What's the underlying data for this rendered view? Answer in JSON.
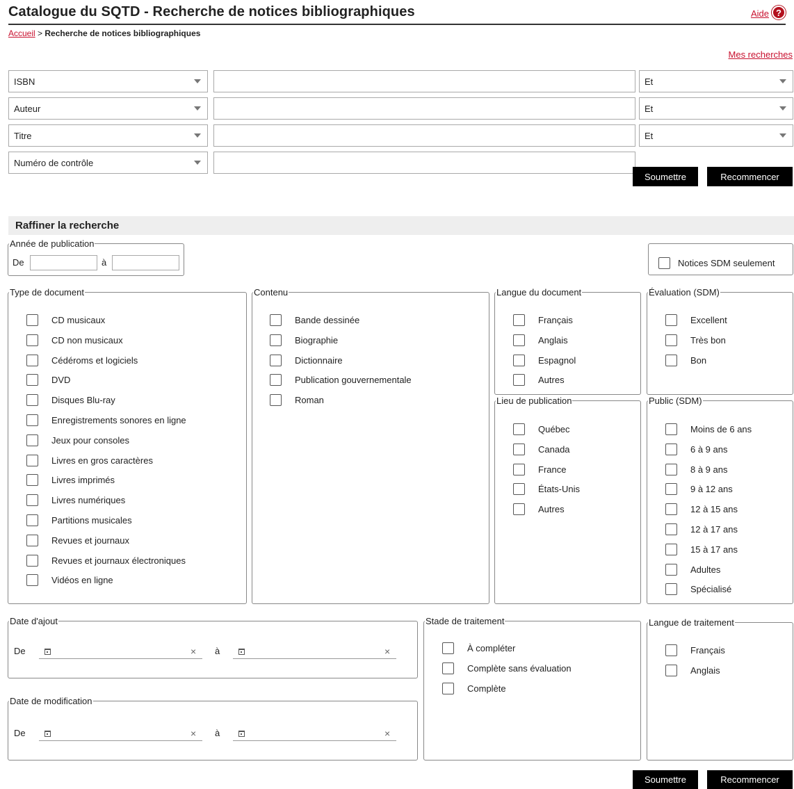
{
  "header": {
    "title": "Catalogue du SQTD - Recherche de notices bibliographiques",
    "help_label": "Aide",
    "help_icon": "?",
    "breadcrumb_home": "Accueil",
    "breadcrumb_sep": ">",
    "breadcrumb_current": "Recherche de notices bibliographiques",
    "my_searches": "Mes recherches"
  },
  "search_rows": [
    {
      "field": "ISBN",
      "operator": "Et"
    },
    {
      "field": "Auteur",
      "operator": "Et"
    },
    {
      "field": "Titre",
      "operator": "Et"
    },
    {
      "field": "Numéro de contrôle"
    }
  ],
  "buttons": {
    "submit": "Soumettre",
    "reset": "Recommencer"
  },
  "refine": {
    "title": "Raffiner la recherche",
    "year": {
      "legend": "Année de publication",
      "from": "De",
      "to": "à"
    },
    "sdm_only": "Notices SDM seulement",
    "doc_type": {
      "legend": "Type de document",
      "items": [
        "CD musicaux",
        "CD non musicaux",
        "Cédéroms et logiciels",
        "DVD",
        "Disques Blu-ray",
        "Enregistrements sonores en ligne",
        "Jeux pour consoles",
        "Livres en gros caractères",
        "Livres imprimés",
        "Livres numériques",
        "Partitions musicales",
        "Revues et journaux",
        "Revues et journaux électroniques",
        "Vidéos en ligne"
      ]
    },
    "content": {
      "legend": "Contenu",
      "items": [
        "Bande dessinée",
        "Biographie",
        "Dictionnaire",
        "Publication gouvernementale",
        "Roman"
      ]
    },
    "doc_lang": {
      "legend": "Langue du document",
      "items": [
        "Français",
        "Anglais",
        "Espagnol",
        "Autres"
      ]
    },
    "evaluation": {
      "legend": "Évaluation (SDM)",
      "items": [
        "Excellent",
        "Très bon",
        "Bon"
      ]
    },
    "pub_place": {
      "legend": "Lieu de publication",
      "items": [
        "Québec",
        "Canada",
        "France",
        "États-Unis",
        "Autres"
      ]
    },
    "audience": {
      "legend": "Public (SDM)",
      "items": [
        "Moins de 6 ans",
        "6 à 9 ans",
        "8 à 9 ans",
        "9 à 12 ans",
        "12 à 15 ans",
        "12 à 17 ans",
        "15 à 17 ans",
        "Adultes",
        "Spécialisé"
      ]
    },
    "date_added": {
      "legend": "Date d'ajout",
      "from": "De",
      "to": "à"
    },
    "date_modified": {
      "legend": "Date de modification",
      "from": "De",
      "to": "à"
    },
    "stage": {
      "legend": "Stade de traitement",
      "items": [
        "À compléter",
        "Complète sans évaluation",
        "Complète"
      ]
    },
    "proc_lang": {
      "legend": "Langue de traitement",
      "items": [
        "Français",
        "Anglais"
      ]
    }
  },
  "colors": {
    "accent": "#c8102e",
    "button_bg": "#000000",
    "refine_bg": "#eeeeee"
  }
}
